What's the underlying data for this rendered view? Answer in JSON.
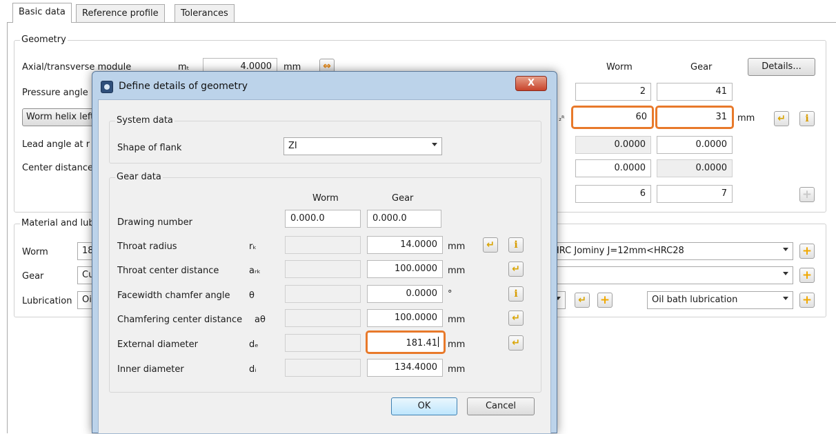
{
  "tabs": [
    "Basic data",
    "Reference profile",
    "Tolerances"
  ],
  "geometry": {
    "title": "Geometry",
    "module_label": "Axial/transverse module",
    "module_symbol": "mₜ",
    "module_value": "4.0000",
    "module_unit": "mm",
    "pressure_label": "Pressure angle",
    "worm_helix_button": "Worm helix left",
    "lead_angle_label": "Lead angle at r",
    "center_distance_label": "Center distance",
    "symbol_2r": "₂ᴿ",
    "col_worm": "Worm",
    "col_gear": "Gear",
    "details_button": "Details...",
    "teeth_worm": "2",
    "teeth_gear": "41",
    "facewidth_worm": "60",
    "facewidth_gear": "31",
    "facewidth_unit": "mm",
    "lead_worm": "0.0000",
    "lead_gear": "0.0000",
    "profile_shift_worm": "0.0000",
    "profile_shift_gear": "0.0000",
    "quality_worm": "6",
    "quality_gear": "7"
  },
  "material": {
    "title": "Material and lub",
    "worm_label": "Worm",
    "worm_prefix": "18",
    "worm_value": "HRC Jominy J=12mm<HRC28",
    "gear_label": "Gear",
    "gear_prefix": "Cu",
    "gear_value": "",
    "lubrication_label": "Lubrication",
    "lubrication_prefix": "Oi",
    "lubrication_value": "Oil bath lubrication"
  },
  "dialog": {
    "title": "Define details of geometry",
    "close_label": "X",
    "system_title": "System data",
    "flank_label": "Shape of flank",
    "flank_value": "ZI",
    "gear_data_title": "Gear data",
    "col_worm": "Worm",
    "col_gear": "Gear",
    "drawing_label": "Drawing number",
    "drawing_worm": "0.000.0",
    "drawing_gear": "0.000.0",
    "throat_radius_label": "Throat radius",
    "throat_radius_symbol": "rₖ",
    "throat_radius_gear": "14.0000",
    "throat_center_label": "Throat center distance",
    "throat_center_symbol": "aᵣₖ",
    "throat_center_gear": "100.0000",
    "chamfer_angle_label": "Facewidth chamfer angle",
    "chamfer_angle_symbol": "θ",
    "chamfer_angle_gear": "0.0000",
    "chamfer_angle_unit": "°",
    "chamfer_dist_label": "Chamfering center distance",
    "chamfer_dist_symbol": "aθ",
    "chamfer_dist_gear": "100.0000",
    "external_label": "External diameter",
    "external_symbol": "dₑ",
    "external_gear": "181.41",
    "inner_label": "Inner diameter",
    "inner_symbol": "dᵢ",
    "inner_gear": "134.4000",
    "unit_mm": "mm",
    "ok_label": "OK",
    "cancel_label": "Cancel"
  },
  "icons": {
    "arrow": "↵",
    "plus": "+",
    "info": "i",
    "swap": "⇔"
  },
  "colors": {
    "highlight": "#e8792a",
    "dialog_frame": "#bcd3ea",
    "tab_active": "#ffffff"
  }
}
